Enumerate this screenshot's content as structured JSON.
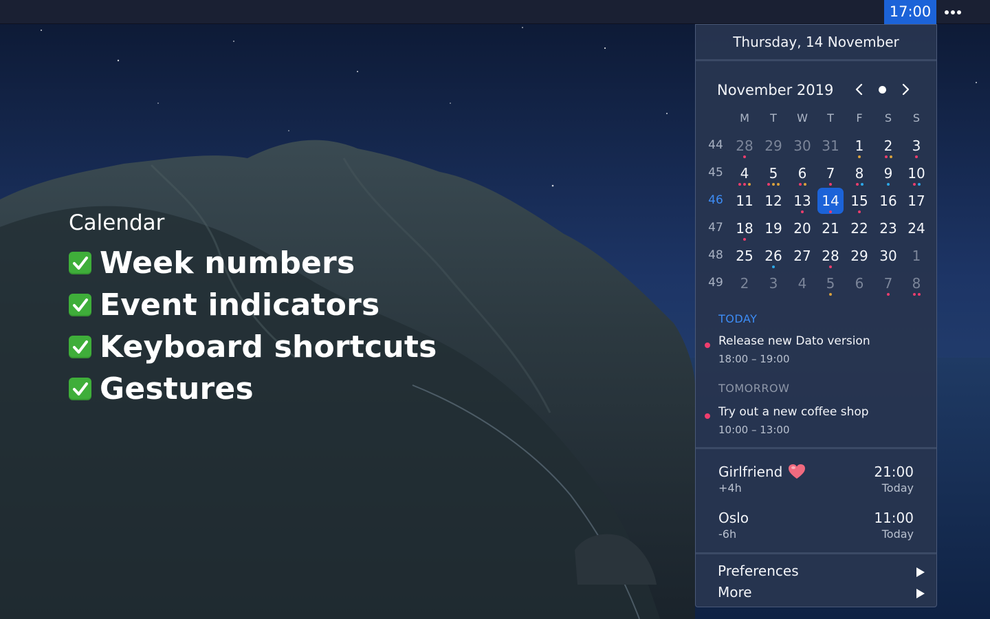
{
  "menubar": {
    "clock": "17:00",
    "more_icon": "ellipsis-icon"
  },
  "features": {
    "title": "Calendar",
    "items": [
      {
        "label": "Week numbers",
        "checked": true
      },
      {
        "label": "Event indicators",
        "checked": true
      },
      {
        "label": "Keyboard shortcuts",
        "checked": true
      },
      {
        "label": "Gestures",
        "checked": true
      }
    ]
  },
  "popover": {
    "date_header": "Thursday, 14 November",
    "calendar": {
      "month_title": "November 2019",
      "weekdays": [
        "M",
        "T",
        "W",
        "T",
        "F",
        "S",
        "S"
      ],
      "weeks": [
        {
          "number": "44",
          "days": [
            {
              "n": "28",
              "out": true,
              "dots": [
                "#ef3d6d"
              ]
            },
            {
              "n": "29",
              "out": true,
              "dots": []
            },
            {
              "n": "30",
              "out": true,
              "dots": []
            },
            {
              "n": "31",
              "out": true,
              "dots": []
            },
            {
              "n": "1",
              "dots": [
                "#d9a13c"
              ]
            },
            {
              "n": "2",
              "dots": [
                "#ef3d6d",
                "#d9a13c"
              ]
            },
            {
              "n": "3",
              "dots": [
                "#ef3d6d"
              ]
            }
          ]
        },
        {
          "number": "45",
          "days": [
            {
              "n": "4",
              "dots": [
                "#ef3d6d",
                "#ef3d6d",
                "#d9a13c"
              ]
            },
            {
              "n": "5",
              "dots": [
                "#ef3d6d",
                "#d9a13c",
                "#d9a13c"
              ]
            },
            {
              "n": "6",
              "dots": [
                "#ef3d6d",
                "#d9a13c"
              ]
            },
            {
              "n": "7",
              "dots": [
                "#ef3d6d"
              ]
            },
            {
              "n": "8",
              "dots": [
                "#ef3d6d",
                "#2da8e8"
              ]
            },
            {
              "n": "9",
              "dots": [
                "#2da8e8"
              ]
            },
            {
              "n": "10",
              "dots": [
                "#ef3d6d",
                "#2da8e8"
              ]
            }
          ]
        },
        {
          "number": "46",
          "current": true,
          "days": [
            {
              "n": "11",
              "dots": []
            },
            {
              "n": "12",
              "dots": []
            },
            {
              "n": "13",
              "dots": [
                "#ef3d6d"
              ]
            },
            {
              "n": "14",
              "today": true,
              "dots": [
                "#ef3d6d"
              ]
            },
            {
              "n": "15",
              "dots": [
                "#ef3d6d"
              ]
            },
            {
              "n": "16",
              "dots": []
            },
            {
              "n": "17",
              "dots": []
            }
          ]
        },
        {
          "number": "47",
          "days": [
            {
              "n": "18",
              "dots": [
                "#ef3d6d"
              ]
            },
            {
              "n": "19",
              "dots": []
            },
            {
              "n": "20",
              "dots": []
            },
            {
              "n": "21",
              "dots": []
            },
            {
              "n": "22",
              "dots": []
            },
            {
              "n": "23",
              "dots": []
            },
            {
              "n": "24",
              "dots": []
            }
          ]
        },
        {
          "number": "48",
          "days": [
            {
              "n": "25",
              "dots": []
            },
            {
              "n": "26",
              "dots": [
                "#2da8e8"
              ]
            },
            {
              "n": "27",
              "dots": []
            },
            {
              "n": "28",
              "dots": [
                "#ef3d6d"
              ]
            },
            {
              "n": "29",
              "dots": []
            },
            {
              "n": "30",
              "dots": []
            },
            {
              "n": "1",
              "out": true,
              "dots": []
            }
          ]
        },
        {
          "number": "49",
          "days": [
            {
              "n": "2",
              "out": true,
              "dots": []
            },
            {
              "n": "3",
              "out": true,
              "dots": []
            },
            {
              "n": "4",
              "out": true,
              "dots": []
            },
            {
              "n": "5",
              "out": true,
              "dots": [
                "#d9a13c"
              ]
            },
            {
              "n": "6",
              "out": true,
              "dots": []
            },
            {
              "n": "7",
              "out": true,
              "dots": [
                "#ef3d6d"
              ]
            },
            {
              "n": "8",
              "out": true,
              "dots": [
                "#ef3d6d",
                "#ef3d6d"
              ]
            }
          ]
        }
      ]
    },
    "agenda": {
      "today_label": "TODAY",
      "today_color": "#3d8cf5",
      "today_event": {
        "title": "Release new Dato version",
        "time": "18:00 – 19:00",
        "color": "#ef3d6d"
      },
      "tomorrow_label": "TOMORROW",
      "tomorrow_color": "#8e97a8",
      "tomorrow_event": {
        "title": "Try out a new coffee shop",
        "time": "10:00 – 13:00",
        "color": "#ef3d6d"
      }
    },
    "timezones": [
      {
        "name": "Girlfriend",
        "emoji_icon": "heart-icon",
        "offset": "+4h",
        "time": "21:00",
        "day": "Today"
      },
      {
        "name": "Oslo",
        "offset": "-6h",
        "time": "11:00",
        "day": "Today"
      }
    ],
    "menu": {
      "preferences": "Preferences",
      "more": "More"
    }
  }
}
